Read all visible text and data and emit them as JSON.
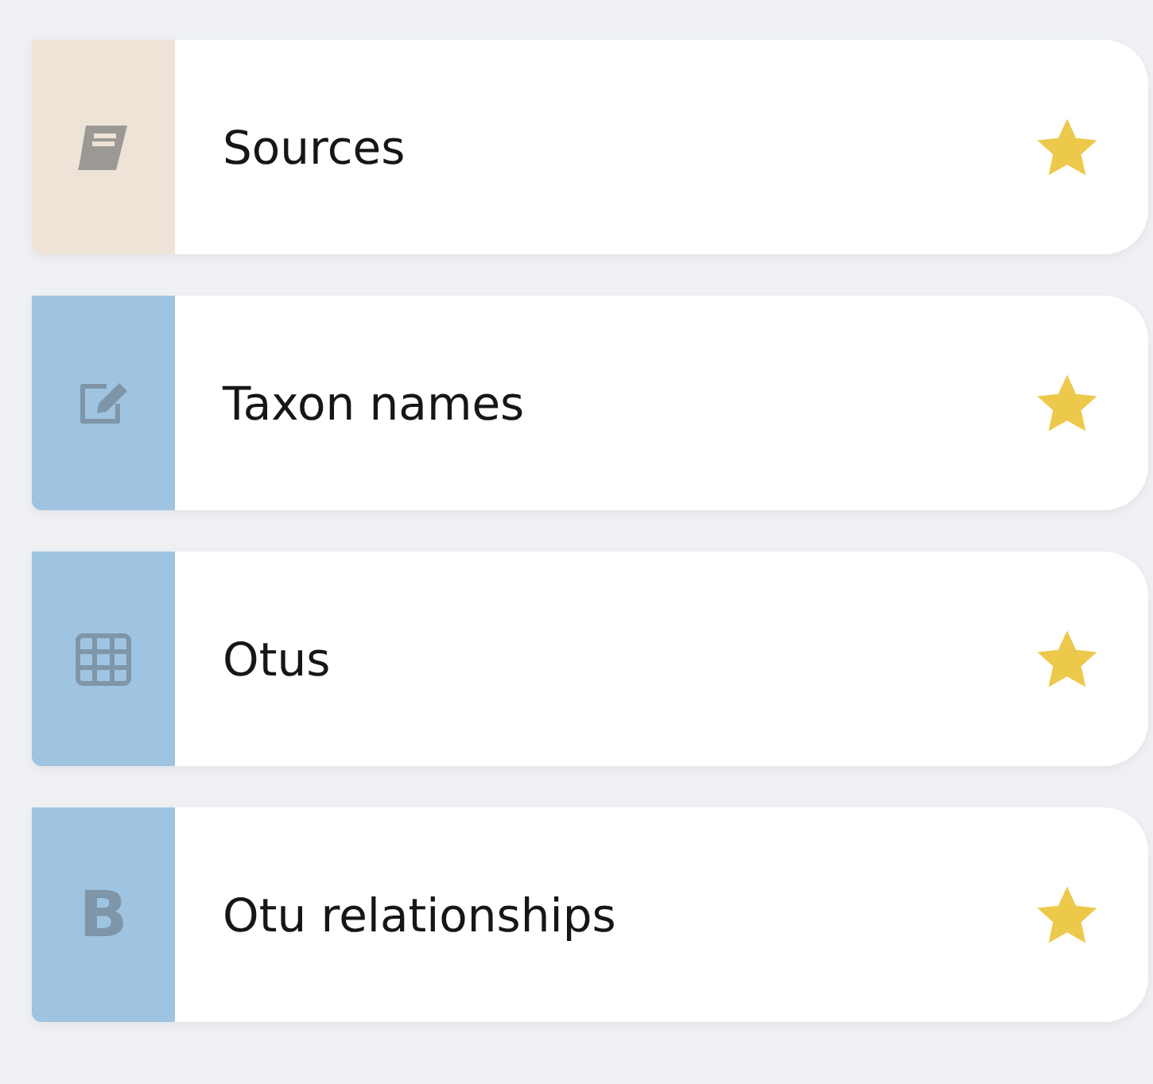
{
  "items": [
    {
      "label": "Sources",
      "kind": "book",
      "color": "#ede3d7",
      "favorite": true
    },
    {
      "label": "Taxon names",
      "kind": "edit",
      "color": "#9fc4e2",
      "favorite": true
    },
    {
      "label": "Otus",
      "kind": "grid",
      "color": "#9fc4e2",
      "favorite": true
    },
    {
      "label": "Otu relationships",
      "kind": "letter",
      "icon_text": "B",
      "color": "#9fc4e2",
      "favorite": true
    }
  ]
}
